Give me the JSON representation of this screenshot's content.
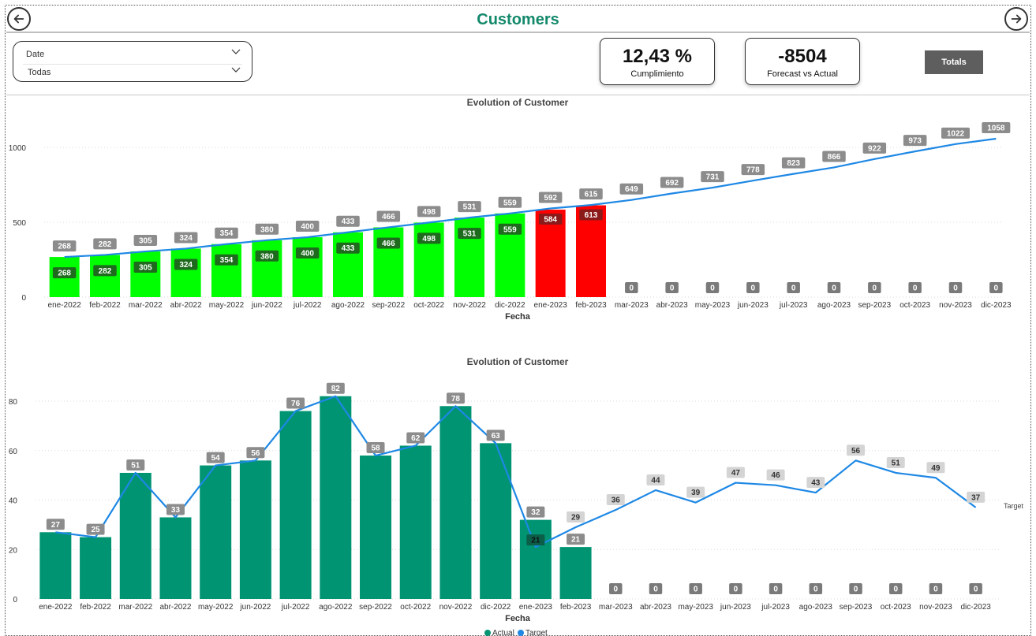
{
  "header": {
    "title": "Customers",
    "back_icon": "arrow-left-circle-icon",
    "forward_icon": "arrow-right-circle-icon"
  },
  "slicer": {
    "label": "Date",
    "value": "Todas"
  },
  "kpis": [
    {
      "value": "12,43 %",
      "label": "Cumplimiento"
    },
    {
      "value": "-8504",
      "label": "Forecast vs Actual"
    }
  ],
  "totals_button": "Totals",
  "colors": {
    "title": "#13896b",
    "green_bar": "#00ff00",
    "red_bar": "#ff0000",
    "teal_bar": "#009473",
    "line": "#1e88e5",
    "label_gray": "#8c8c8c",
    "label_dark_green": "#1e6b1e",
    "label_dark_red": "#8b1a1a"
  },
  "chart_data": [
    {
      "type": "bar",
      "title": "Evolution of Customer",
      "xlabel": "Fecha",
      "ylabel": "",
      "ylim": [
        0,
        1000
      ],
      "yticks": [
        0,
        500,
        1000
      ],
      "categories": [
        "ene-2022",
        "feb-2022",
        "mar-2022",
        "abr-2022",
        "may-2022",
        "jun-2022",
        "jul-2022",
        "ago-2022",
        "sep-2022",
        "oct-2022",
        "nov-2022",
        "dic-2022",
        "ene-2023",
        "feb-2023",
        "mar-2023",
        "abr-2023",
        "may-2023",
        "jun-2023",
        "jul-2023",
        "ago-2023",
        "sep-2023",
        "oct-2023",
        "nov-2023",
        "dic-2023"
      ],
      "series": [
        {
          "kind": "bar",
          "values": [
            268,
            282,
            305,
            324,
            354,
            380,
            400,
            433,
            466,
            498,
            531,
            559,
            584,
            613,
            0,
            0,
            0,
            0,
            0,
            0,
            0,
            0,
            0,
            0
          ],
          "colors": [
            "#00ff00",
            "#00ff00",
            "#00ff00",
            "#00ff00",
            "#00ff00",
            "#00ff00",
            "#00ff00",
            "#00ff00",
            "#00ff00",
            "#00ff00",
            "#00ff00",
            "#00ff00",
            "#ff0000",
            "#ff0000",
            "#00ff00",
            "#00ff00",
            "#00ff00",
            "#00ff00",
            "#00ff00",
            "#00ff00",
            "#00ff00",
            "#00ff00",
            "#00ff00",
            "#00ff00"
          ]
        },
        {
          "kind": "line",
          "values": [
            268,
            282,
            305,
            324,
            354,
            380,
            400,
            433,
            466,
            498,
            531,
            559,
            592,
            615,
            649,
            692,
            731,
            778,
            823,
            866,
            922,
            973,
            1022,
            1058
          ]
        }
      ],
      "grid": true
    },
    {
      "type": "bar",
      "title": "Evolution of Customer",
      "xlabel": "Fecha",
      "ylabel": "",
      "ylim": [
        0,
        80
      ],
      "yticks": [
        0,
        20,
        40,
        60,
        80
      ],
      "categories": [
        "ene-2022",
        "feb-2022",
        "mar-2022",
        "abr-2022",
        "may-2022",
        "jun-2022",
        "jul-2022",
        "ago-2022",
        "sep-2022",
        "oct-2022",
        "nov-2022",
        "dic-2022",
        "ene-2023",
        "feb-2023",
        "mar-2023",
        "abr-2023",
        "may-2023",
        "jun-2023",
        "jul-2023",
        "ago-2023",
        "sep-2023",
        "oct-2023",
        "nov-2023",
        "dic-2023"
      ],
      "series": [
        {
          "kind": "bar",
          "name": "Actual",
          "values": [
            27,
            25,
            51,
            33,
            54,
            56,
            76,
            82,
            58,
            62,
            78,
            63,
            32,
            21,
            0,
            0,
            0,
            0,
            0,
            0,
            0,
            0,
            0,
            0
          ]
        },
        {
          "kind": "line",
          "name": "Target",
          "values": [
            27,
            25,
            51,
            33,
            54,
            56,
            76,
            82,
            58,
            62,
            78,
            63,
            21,
            29,
            36,
            44,
            39,
            47,
            46,
            43,
            56,
            51,
            49,
            37
          ]
        }
      ],
      "line_end_label": "Target",
      "legend": [
        "Actual",
        "Target"
      ],
      "legend_position": "bottom",
      "grid": true
    }
  ]
}
